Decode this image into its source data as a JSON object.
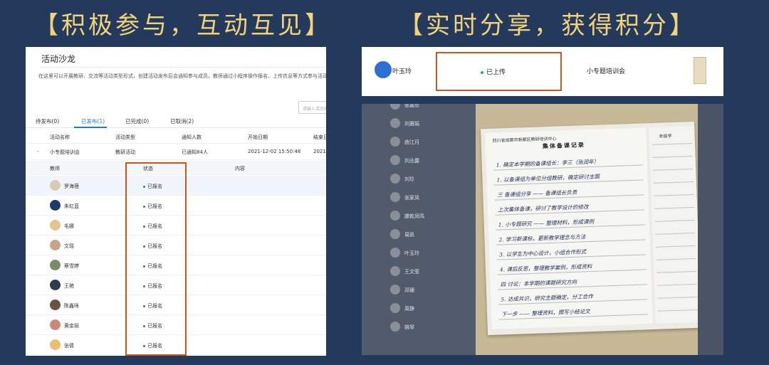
{
  "titles": {
    "left": "【积极参与，互动互见】",
    "right": "【实时分享，获得积分】"
  },
  "salon": {
    "title": "活动沙龙",
    "description": "在这里可以开展教研、交流等活动类型形式，创建活动发布后会通知参与成员，教师通过小程序操作报名、上传信息等方式参与活动",
    "search_placeholder": "请输入活动名称",
    "tabs": [
      {
        "label": "待发布(0)",
        "active": false
      },
      {
        "label": "已发布(1)",
        "active": true
      },
      {
        "label": "已完成(0)",
        "active": false
      },
      {
        "label": "已取消(2)",
        "active": false
      }
    ],
    "columns": [
      "活动名称",
      "活动类型",
      "通知人数",
      "开始日期",
      "结束日"
    ],
    "activity": {
      "expander": "-",
      "name": "小专题培训会",
      "type": "教研活动",
      "notified": "已通知84人",
      "start": "2021-12-02 15:50:48",
      "end": "2021"
    },
    "sub_columns": [
      "教师",
      "状态",
      "内容"
    ],
    "teachers": [
      {
        "name": "罗海蓓",
        "status": "已报名",
        "avatar_color": "#d9c9b8"
      },
      {
        "name": "朱虹蓝",
        "status": "已报名",
        "avatar_color": "#1d3a6b"
      },
      {
        "name": "毛娜",
        "status": "已报名",
        "avatar_color": "#e6c48a"
      },
      {
        "name": "文瑶",
        "status": "已报名",
        "avatar_color": "#c9a48a"
      },
      {
        "name": "蔡雪婷",
        "status": "已报名",
        "avatar_color": "#7b8a6a"
      },
      {
        "name": "王艳",
        "status": "已报名",
        "avatar_color": "#2c3b52"
      },
      {
        "name": "陈鑫咪",
        "status": "已报名",
        "avatar_color": "#6b5142"
      },
      {
        "name": "黄金丽",
        "status": "已报名",
        "avatar_color": "#c98a7a"
      },
      {
        "name": "张倩",
        "status": "已报名",
        "avatar_color": "#e8c070"
      }
    ]
  },
  "share": {
    "name": "叶玉玲",
    "status": "已上传",
    "activity": "小专题培训会"
  },
  "background_list": [
    "张嘉欣",
    "刘雅娟",
    "曲江月",
    "刘丛露",
    "刘珍",
    "张家凤",
    "滕乾凤鸣",
    "易凯",
    "叶玉玲",
    "王文莹",
    "邓珊",
    "周静",
    "姚琴"
  ],
  "notebook": {
    "header": "四川省成都市新都区教研培训中心",
    "title": "集体备课记录",
    "right_title": "年级学",
    "lines": [
      "1. 确定本学期的备课组长：李三（张润年）",
      "1. 以备课组为单位分组教研，确定研讨主题",
      "三 备课组分享 —— 备课组长负责",
      "上次集体备课，研讨了教学设计的修改",
      "1. 小专题研究 —— 整理材料，形成课例",
      "2. 学习新课标，更新教学理念与方法",
      "3. 以学生为中心设计，小组合作形式",
      "4. 课后反思，整理教学案例，形成资料",
      "四 讨论：本学期的课题研究方向",
      "5. 达成共识，研究主题确定，分工合作",
      "下一步 —— 整理资料，撰写小结论文"
    ]
  },
  "colors": {
    "background": "#243a5c",
    "title_gold": "#f2d27a",
    "highlight": "#c25a1f",
    "tab_active": "#1f78d1",
    "upload_green": "#2bb24c"
  }
}
